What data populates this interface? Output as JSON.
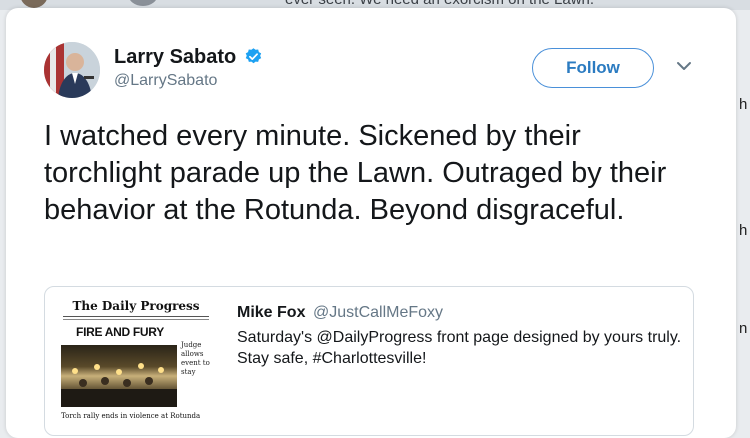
{
  "background": {
    "snippet": "ever seen. We need an exorcism on the Lawn.",
    "side_letters": [
      "h",
      "h",
      "n"
    ]
  },
  "tweet": {
    "author_name": "Larry Sabato",
    "author_handle": "@LarrySabato",
    "verified": true,
    "follow_label": "Follow",
    "text": "I watched every minute. Sickened by their torchlight parade up the Lawn. Outraged by their behavior at the Rotunda. Beyond disgraceful."
  },
  "quoted_tweet": {
    "author_name": "Mike Fox",
    "author_handle": "@JustCallMeFoxy",
    "text": "Saturday's @DailyProgress front page designed by yours truly. Stay safe, #Charlottesville!",
    "thumbnail": {
      "masthead": "The Daily Progress",
      "headline": "FIRE AND FURY",
      "sidebar_text": "Judge allows event to stay",
      "caption": "Torch rally ends in violence at Rotunda"
    }
  },
  "colors": {
    "accent": "#2b7bc1",
    "verified_badge": "#1da1f2",
    "secondary_text": "#657786"
  },
  "icons": {
    "verified": "verified-badge-icon",
    "menu": "chevron-down-icon"
  }
}
